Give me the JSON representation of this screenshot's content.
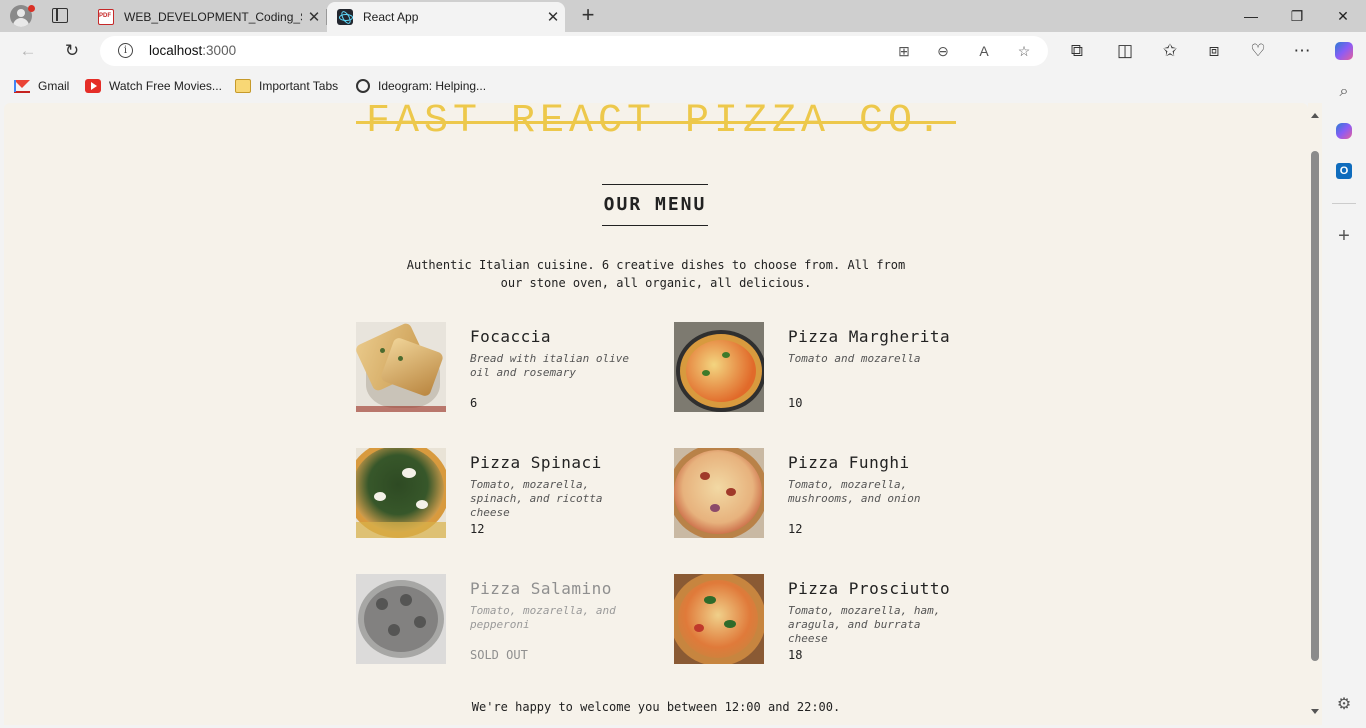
{
  "browser": {
    "tabs": [
      {
        "title": "WEB_DEVELOPMENT_Coding_SA",
        "active": false
      },
      {
        "title": "React App",
        "active": true
      }
    ],
    "address": {
      "host": "localhost",
      "port": ":3000"
    },
    "bookmarks": [
      {
        "label": "Gmail",
        "icon": "gmail-icon"
      },
      {
        "label": "Watch Free Movies...",
        "icon": "youtube-icon"
      },
      {
        "label": "Important Tabs",
        "icon": "folder-icon"
      },
      {
        "label": "Ideogram: Helping...",
        "icon": "ideogram-icon"
      }
    ]
  },
  "page": {
    "brand": "Fast React Pizza Co.",
    "menu_heading": "Our Menu",
    "intro": "Authentic Italian cuisine. 6 creative dishes to choose from. All from our stone oven, all organic, all delicious.",
    "pizzas": [
      {
        "name": "Focaccia",
        "ingredients": "Bread with italian olive oil and rosemary",
        "price": "6",
        "sold_out": false
      },
      {
        "name": "Pizza Margherita",
        "ingredients": "Tomato and mozarella",
        "price": "10",
        "sold_out": false
      },
      {
        "name": "Pizza Spinaci",
        "ingredients": "Tomato, mozarella, spinach, and ricotta cheese",
        "price": "12",
        "sold_out": false
      },
      {
        "name": "Pizza Funghi",
        "ingredients": "Tomato, mozarella, mushrooms, and onion",
        "price": "12",
        "sold_out": false
      },
      {
        "name": "Pizza Salamino",
        "ingredients": "Tomato, mozarella, and pepperoni",
        "price": "SOLD OUT",
        "sold_out": true
      },
      {
        "name": "Pizza Prosciutto",
        "ingredients": "Tomato, mozarella, ham, aragula, and burrata cheese",
        "price": "18",
        "sold_out": false
      }
    ],
    "footer": "We're happy to welcome you between 12:00 and 22:00."
  },
  "colors": {
    "accent": "#edc84b",
    "page_background": "#f6f2ea",
    "text": "#222222"
  }
}
